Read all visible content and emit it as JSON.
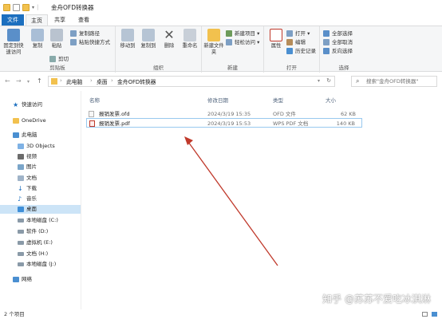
{
  "window": {
    "title": "金舟OFD转换器"
  },
  "tabs": [
    {
      "label": "文件"
    },
    {
      "label": "主页"
    },
    {
      "label": "共享"
    },
    {
      "label": "查看"
    }
  ],
  "ribbon": {
    "clipboard": {
      "pin": "固定到快速访问",
      "copy": "复制",
      "paste": "粘贴",
      "copy_path": "复制路径",
      "paste_shortcut": "粘贴快捷方式",
      "cut": "剪切",
      "group": "剪贴板"
    },
    "organize": {
      "move_to": "移动到",
      "copy_to": "复制到",
      "delete": "删除",
      "rename": "重命名",
      "group": "组织"
    },
    "new": {
      "new_folder": "新建文件夹",
      "new_item": "新建项目 ▾",
      "easy_access": "轻松访问 ▾",
      "group": "新建"
    },
    "open": {
      "properties": "属性",
      "open": "打开 ▾",
      "edit": "编辑",
      "history": "历史记录",
      "group": "打开"
    },
    "select": {
      "select_all": "全部选择",
      "select_none": "全部取消",
      "invert": "反向选择",
      "group": "选择"
    }
  },
  "address": {
    "crumbs": [
      "此电脑",
      "桌面",
      "金舟OFD转换器"
    ],
    "search_placeholder": "搜索\"金舟OFD转换器\""
  },
  "nav": [
    {
      "label": "快速访问",
      "icon": "star-icon"
    },
    {
      "label": "OneDrive",
      "icon": "cloud-icon"
    },
    {
      "label": "此电脑",
      "icon": "computer-icon"
    },
    {
      "label": "3D Objects",
      "icon": "cube-icon"
    },
    {
      "label": "视频",
      "icon": "video-icon"
    },
    {
      "label": "图片",
      "icon": "picture-icon"
    },
    {
      "label": "文档",
      "icon": "document-icon"
    },
    {
      "label": "下载",
      "icon": "download-icon"
    },
    {
      "label": "音乐",
      "icon": "music-icon"
    },
    {
      "label": "桌面",
      "icon": "desktop-icon"
    },
    {
      "label": "本地磁盘 (C:)",
      "icon": "drive-icon"
    },
    {
      "label": "软件 (D:)",
      "icon": "drive-icon"
    },
    {
      "label": "虚拟机 (E:)",
      "icon": "drive-icon"
    },
    {
      "label": "文档 (H:)",
      "icon": "drive-icon"
    },
    {
      "label": "本地磁盘 (J:)",
      "icon": "drive-icon"
    },
    {
      "label": "网络",
      "icon": "network-icon"
    }
  ],
  "columns": [
    "名称",
    "修改日期",
    "类型",
    "大小"
  ],
  "files": [
    {
      "name": "报销发票.ofd",
      "date": "2024/3/19 15:35",
      "type": "OFD 文件",
      "size": "62 KB"
    },
    {
      "name": "报销发票.pdf",
      "date": "2024/3/19 15:53",
      "type": "WPS PDF 文档",
      "size": "140 KB"
    }
  ],
  "status": {
    "count": "2 个项目"
  },
  "watermark": "知乎 @苏苏不爱吃冰淇淋",
  "colors": {
    "accent": "#1c6fbf",
    "selection": "#cce4f7",
    "arrow": "#c0392b"
  }
}
